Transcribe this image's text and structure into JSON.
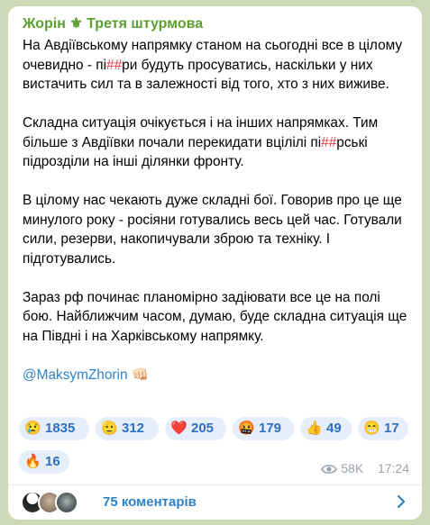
{
  "post": {
    "channel": "Жорін ⚜ Третя штурмова",
    "paragraphs": [
      [
        "На Авдіївському напрямку станом на сьогодні все в цілому очевидно - пі",
        "##",
        "ри будуть просуватись, наскільки у них вистачить сил та в залежності від того, хто з них виживе."
      ],
      [
        "Складна ситуація очікується і на інших напрямках. Тим більше з Авдіївки почали перекидати вцілілі пі",
        "##",
        "рські підрозділи на інші ділянки фронту."
      ],
      [
        "В цілому нас чекають дуже складні бої. Говорив про це ще минулого року - росіяни готувались весь цей час. Готували сили, резерви, накопичували зброю та техніку. І підготувались."
      ],
      [
        "Зараз рф починає планомірно задіювати все це на полі бою. Найближчим часом, думаю, буде складна ситуація ще на Півдні і на Харківському напрямку."
      ]
    ],
    "link": "@MaksymZhorin",
    "link_emoji": "👊🏻"
  },
  "reactions": [
    {
      "emoji": "😢",
      "count": "1835"
    },
    {
      "emoji": "🫡",
      "count": "312"
    },
    {
      "emoji": "❤️",
      "count": "205"
    },
    {
      "emoji": "🤬",
      "count": "179"
    },
    {
      "emoji": "👍",
      "count": "49"
    },
    {
      "emoji": "😁",
      "count": "17"
    },
    {
      "emoji": "🔥",
      "count": "16"
    }
  ],
  "meta": {
    "views": "58K",
    "time": "17:24"
  },
  "comments": {
    "label": "75 коментарів"
  },
  "colors": {
    "accent": "#2d82c8",
    "channel": "#5c9e31",
    "redaction": "#e8394a"
  }
}
